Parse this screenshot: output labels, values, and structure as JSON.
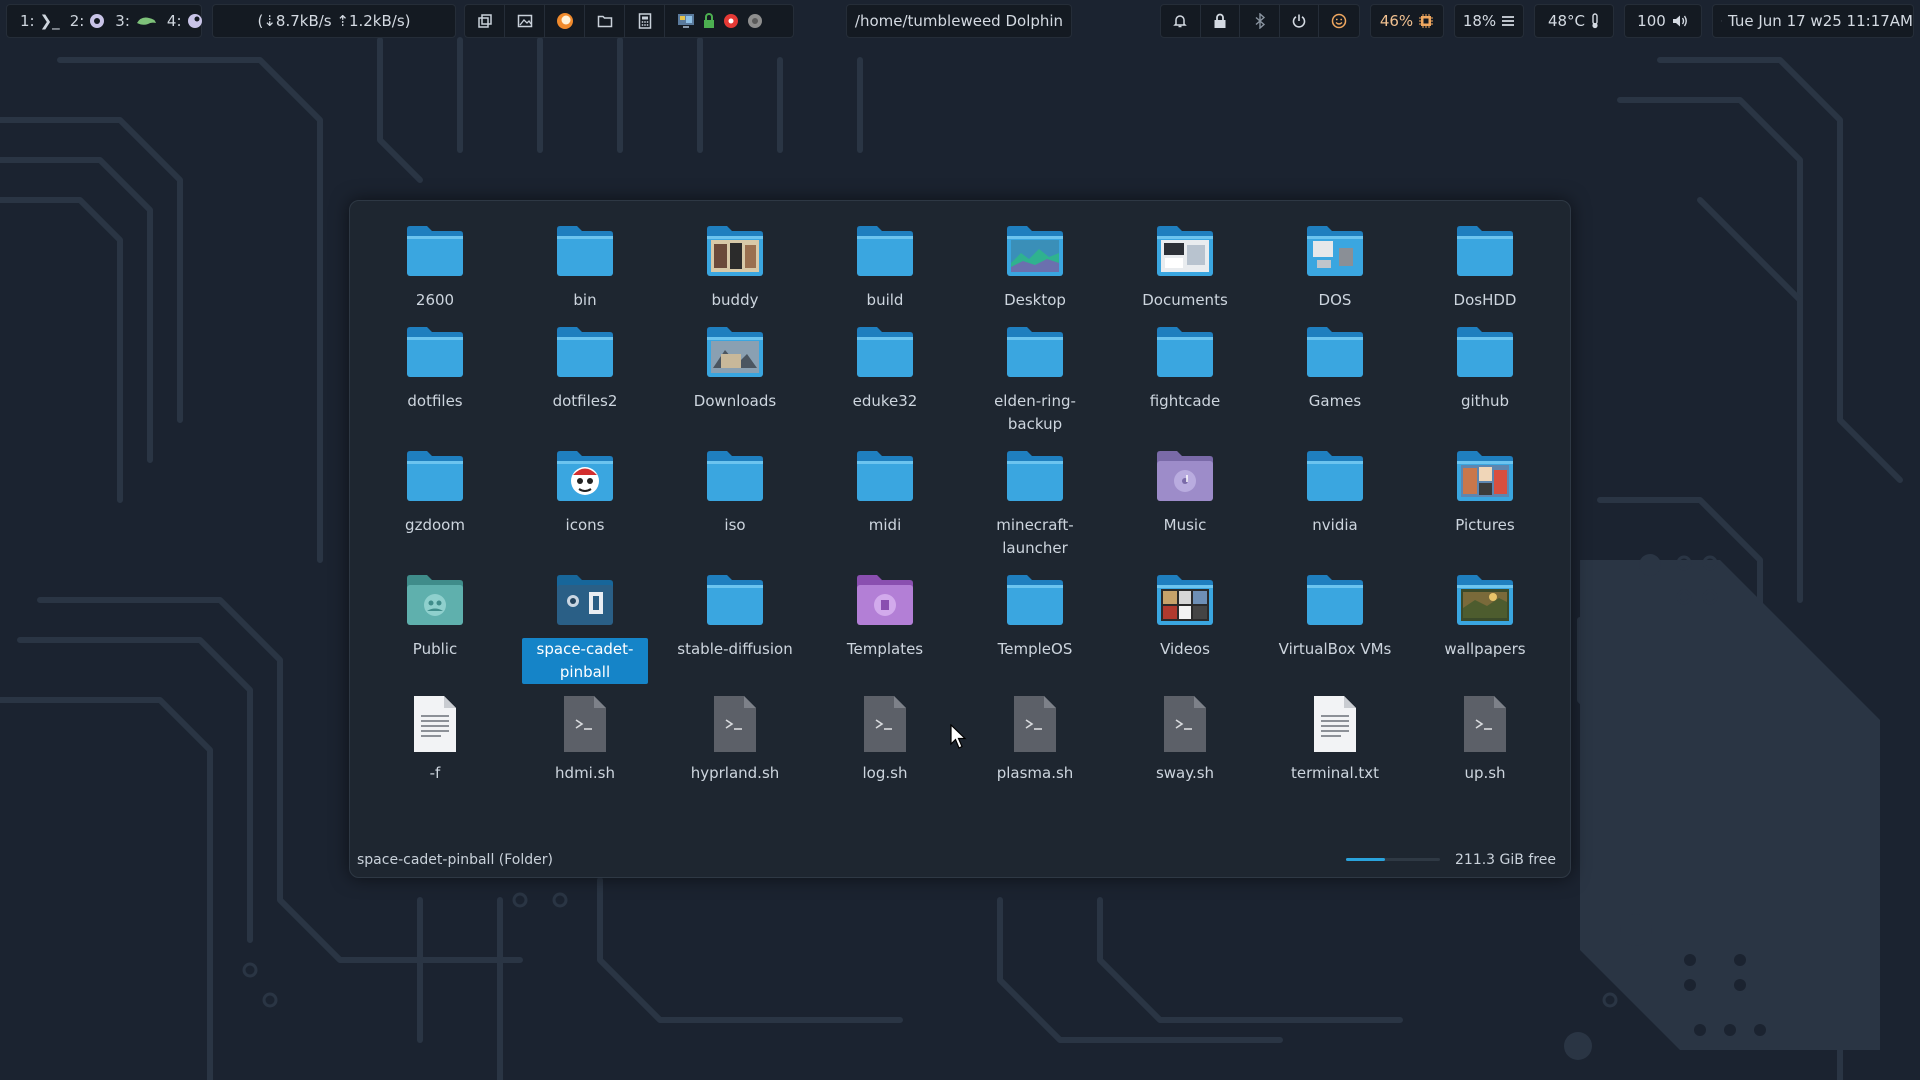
{
  "topbar": {
    "workspaces": [
      {
        "label": "1:",
        "icon": "terminal-icon",
        "glyph": "❯_"
      },
      {
        "label": "2:",
        "icon": "browser-icon",
        "glyph": "◉"
      },
      {
        "label": "3:",
        "icon": "chameleon-icon",
        "glyph": "🦎"
      },
      {
        "label": "4:",
        "icon": "steam-icon",
        "glyph": "◐"
      }
    ],
    "network": "(⇣8.7kB/s ⇡1.2kB/s)",
    "window_title": "/home/tumbleweed Dolphin",
    "battery": "46%",
    "cpu": "18%",
    "temperature": "48°C",
    "volume": "100",
    "clock": "Tue Jun 17 w25 11:17AM"
  },
  "window": {
    "items": [
      {
        "label": "2600",
        "icon": "folder-icon",
        "kind": "folder"
      },
      {
        "label": "bin",
        "icon": "folder-icon",
        "kind": "folder"
      },
      {
        "label": "buddy",
        "icon": "folder-thumbnail-icon",
        "kind": "thumb1"
      },
      {
        "label": "build",
        "icon": "folder-icon",
        "kind": "folder"
      },
      {
        "label": "Desktop",
        "icon": "desktop-folder-icon",
        "kind": "desktop"
      },
      {
        "label": "Documents",
        "icon": "documents-folder-icon",
        "kind": "thumb2"
      },
      {
        "label": "DOS",
        "icon": "folder-thumbnail-icon",
        "kind": "thumb3"
      },
      {
        "label": "DosHDD",
        "icon": "folder-icon",
        "kind": "folder"
      },
      {
        "label": "dotfiles",
        "icon": "folder-icon",
        "kind": "folder"
      },
      {
        "label": "dotfiles2",
        "icon": "folder-icon",
        "kind": "folder"
      },
      {
        "label": "Downloads",
        "icon": "downloads-folder-icon",
        "kind": "thumb4"
      },
      {
        "label": "eduke32",
        "icon": "folder-icon",
        "kind": "folder"
      },
      {
        "label": "elden-ring-backup",
        "icon": "folder-icon",
        "kind": "folder"
      },
      {
        "label": "fightcade",
        "icon": "folder-icon",
        "kind": "folder"
      },
      {
        "label": "Games",
        "icon": "folder-icon",
        "kind": "folder"
      },
      {
        "label": "github",
        "icon": "folder-icon",
        "kind": "folder"
      },
      {
        "label": "gzdoom",
        "icon": "folder-icon",
        "kind": "folder"
      },
      {
        "label": "icons",
        "icon": "folder-thumbnail-icon",
        "kind": "thumb5"
      },
      {
        "label": "iso",
        "icon": "folder-icon",
        "kind": "folder"
      },
      {
        "label": "midi",
        "icon": "folder-icon",
        "kind": "folder"
      },
      {
        "label": "minecraft-launcher",
        "icon": "folder-icon",
        "kind": "folder"
      },
      {
        "label": "Music",
        "icon": "music-folder-icon",
        "kind": "music"
      },
      {
        "label": "nvidia",
        "icon": "folder-icon",
        "kind": "folder"
      },
      {
        "label": "Pictures",
        "icon": "pictures-folder-icon",
        "kind": "thumb6"
      },
      {
        "label": "Public",
        "icon": "public-folder-icon",
        "kind": "public"
      },
      {
        "label": "space-cadet-pinball",
        "icon": "folder-thumbnail-icon",
        "kind": "thumb7",
        "selected": true
      },
      {
        "label": "stable-diffusion",
        "icon": "folder-icon",
        "kind": "folder"
      },
      {
        "label": "Templates",
        "icon": "templates-folder-icon",
        "kind": "templates"
      },
      {
        "label": "TempleOS",
        "icon": "folder-icon",
        "kind": "folder"
      },
      {
        "label": "Videos",
        "icon": "videos-folder-icon",
        "kind": "thumb8"
      },
      {
        "label": "VirtualBox VMs",
        "icon": "folder-icon",
        "kind": "folder"
      },
      {
        "label": "wallpapers",
        "icon": "folder-thumbnail-icon",
        "kind": "thumb9"
      },
      {
        "label": "-f",
        "icon": "text-file-icon",
        "kind": "text"
      },
      {
        "label": "hdmi.sh",
        "icon": "script-file-icon",
        "kind": "script"
      },
      {
        "label": "hyprland.sh",
        "icon": "script-file-icon",
        "kind": "script"
      },
      {
        "label": "log.sh",
        "icon": "script-file-icon",
        "kind": "script"
      },
      {
        "label": "plasma.sh",
        "icon": "script-file-icon",
        "kind": "script"
      },
      {
        "label": "sway.sh",
        "icon": "script-file-icon",
        "kind": "script"
      },
      {
        "label": "terminal.txt",
        "icon": "text-file-icon",
        "kind": "text"
      },
      {
        "label": "up.sh",
        "icon": "script-file-icon",
        "kind": "script"
      }
    ],
    "status_text": "space-cadet-pinball (Folder)",
    "free_space": "211.3 GiB free",
    "disk_used_fraction": 0.42
  },
  "colors": {
    "folder": "#3aa6e0",
    "folder_dark": "#1f7fbf",
    "selection": "#1584c8",
    "accent": "#2aa3dc"
  }
}
